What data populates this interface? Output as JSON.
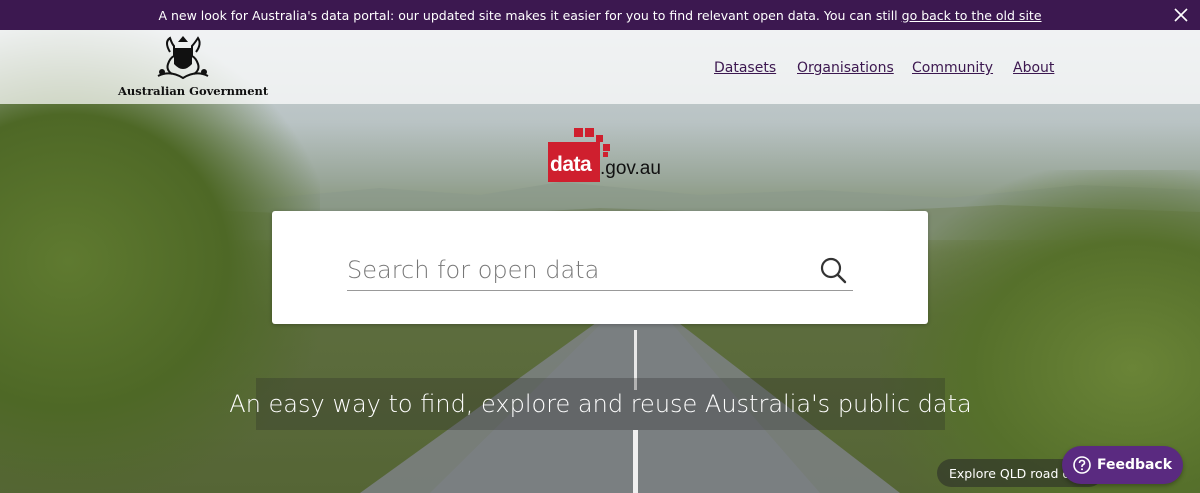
{
  "banner": {
    "text": "A new look for Australia's data portal: our updated site makes it easier for you to find relevant open data. You can still",
    "link": "go back to the old site",
    "close_icon": "close-icon"
  },
  "header": {
    "gov_name": "Australian Government",
    "nav": [
      "Datasets",
      "Organisations",
      "Community",
      "About"
    ]
  },
  "brand": {
    "data_word": "data",
    "domain": ".gov.au",
    "color": "#cf1f2e"
  },
  "search": {
    "placeholder": "Search for open data",
    "icon": "search-icon"
  },
  "tagline": "An easy way to find, explore and reuse Australia's public data",
  "explore": "Explore QLD road data",
  "feedback": {
    "label": "Feedback",
    "icon": "question-icon"
  },
  "colors": {
    "banner_bg": "#3c1850",
    "nav_link": "#3c1850",
    "feedback_bg": "#5a2a80"
  }
}
